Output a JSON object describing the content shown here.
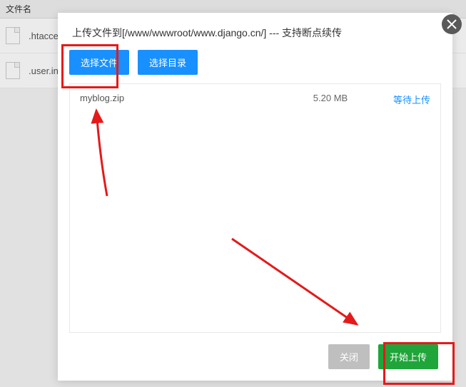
{
  "background": {
    "column_header": "文件名",
    "files": [
      {
        "name": ".htaccess"
      },
      {
        "name": ".user.ini"
      }
    ]
  },
  "dialog": {
    "title": "上传文件到[/www/wwwroot/www.django.cn/] --- 支持断点续传",
    "toolbar": {
      "select_file": "选择文件",
      "select_dir": "选择目录"
    },
    "file_list": [
      {
        "filename": "myblog.zip",
        "size": "5.20 MB",
        "status": "等待上传"
      }
    ],
    "footer": {
      "close": "关闭",
      "start_upload": "开始上传"
    }
  },
  "annotations": {
    "highlight_color": "#e41a1a"
  }
}
